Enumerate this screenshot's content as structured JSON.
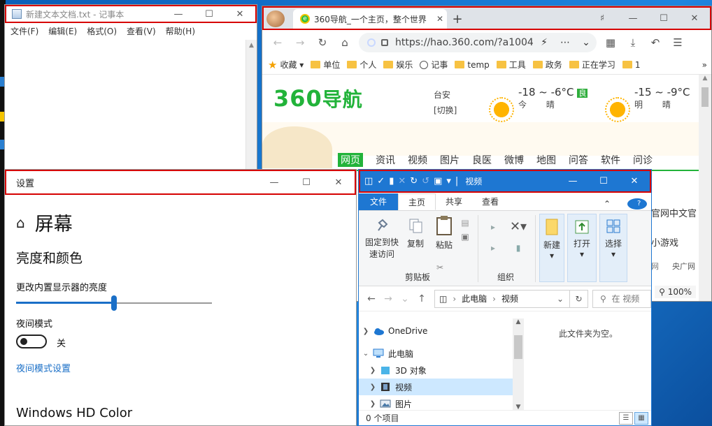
{
  "notepad": {
    "title": "新建文本文档.txt - 记事本",
    "menu": [
      "文件(F)",
      "编辑(E)",
      "格式(O)",
      "查看(V)",
      "帮助(H)"
    ]
  },
  "browser": {
    "tab_title": "360导航_一个主页，整个世界",
    "url": "https://hao.360.com/?a1004",
    "bookmarks": [
      "收藏",
      "单位",
      "个人",
      "娱乐",
      "记事",
      "temp",
      "工具",
      "政务",
      "正在学习",
      "1"
    ],
    "logo": "360",
    "logo_cn": "导航",
    "city": "台安",
    "city_switch": "[切换]",
    "weather_today_temp": "-18 ~ -6°C",
    "weather_today_aqi": "良",
    "weather_today_label": "今 晴",
    "weather_tomorrow_temp": "-15 ~ -9°C",
    "weather_tomorrow_label": "明 晴",
    "nav": [
      "网页",
      "资讯",
      "视频",
      "图片",
      "良医",
      "微博",
      "地图",
      "问答",
      "软件",
      "问诊"
    ],
    "frag_1": "官网中文官",
    "frag_2": "小游戏",
    "frag_3": "网",
    "frag_4": "央广网",
    "zoom": "100%"
  },
  "settings": {
    "title": "设置",
    "page_title": "屏幕",
    "section_brightness": "亮度和颜色",
    "brightness_label": "更改内置显示器的亮度",
    "brightness_value": 0.5,
    "night_label": "夜间模式",
    "night_state": "关",
    "night_link": "夜间模式设置",
    "hd_color": "Windows HD Color"
  },
  "explorer": {
    "title": "视频",
    "tabs": [
      "文件",
      "主页",
      "共享",
      "查看"
    ],
    "ribbon": {
      "pin": "固定到快速访问",
      "copy": "复制",
      "paste": "粘贴",
      "clipboard_group": "剪贴板",
      "organize_group": "组织",
      "new": "新建",
      "open": "打开",
      "select": "选择"
    },
    "path_root": "此电脑",
    "path_leaf": "视频",
    "search_placeholder": "在 视频",
    "tree": [
      "OneDrive",
      "此电脑",
      "3D 对象",
      "视频",
      "图片"
    ],
    "empty_text": "此文件夹为空。",
    "status": "0 个项目"
  }
}
